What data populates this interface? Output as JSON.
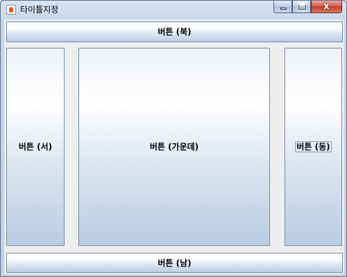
{
  "window": {
    "title": "타이틀지정",
    "controls": {
      "minimize": "",
      "maximize": "",
      "close": "x"
    }
  },
  "buttons": {
    "north": "버튼 (북)",
    "west": "버튼 (서)",
    "center": "버튼 (가운데)",
    "east": "버튼 (동)",
    "south": "버튼 (남)"
  },
  "focused_button": "east"
}
